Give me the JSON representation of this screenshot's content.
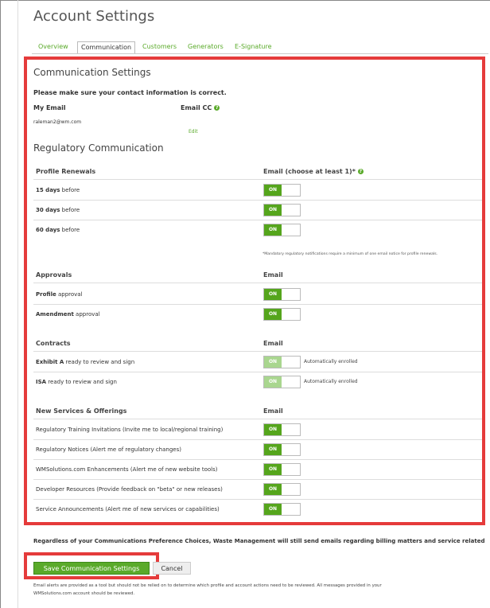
{
  "page": {
    "title": "Account Settings"
  },
  "tabs": [
    {
      "label": "Overview"
    },
    {
      "label": "Communication"
    },
    {
      "label": "Customers"
    },
    {
      "label": "Generators"
    },
    {
      "label": "E-Signature"
    }
  ],
  "communication": {
    "heading": "Communication Settings",
    "notice": "Please make sure your contact information is correct.",
    "my_email_label": "My Email",
    "my_email_value": "raleman2@wm.com",
    "email_cc_label": "Email CC",
    "edit_label": "Edit"
  },
  "regulatory": {
    "heading": "Regulatory Communication",
    "profile_renewals": {
      "header": "Profile Renewals",
      "email_header": "Email (choose at least 1)*",
      "rows": [
        {
          "bold": "15 days",
          "rest": " before",
          "toggle": "ON"
        },
        {
          "bold": "30 days",
          "rest": " before",
          "toggle": "ON"
        },
        {
          "bold": "60 days",
          "rest": " before",
          "toggle": "ON"
        }
      ],
      "footnote": "*Mandatory regulatory notifications require a minimum of one email notice for profile renewals."
    },
    "approvals": {
      "header": "Approvals",
      "email_header": "Email",
      "rows": [
        {
          "bold": "Profile",
          "rest": " approval",
          "toggle": "ON"
        },
        {
          "bold": "Amendment",
          "rest": " approval",
          "toggle": "ON"
        }
      ]
    },
    "contracts": {
      "header": "Contracts",
      "email_header": "Email",
      "rows": [
        {
          "bold": "Exhibit A",
          "rest": " ready to review and sign",
          "toggle": "ON",
          "note": "Automatically enrolled"
        },
        {
          "bold": "ISA",
          "rest": " ready to review and sign",
          "toggle": "ON",
          "note": "Automatically enrolled"
        }
      ]
    },
    "services": {
      "header": "New Services & Offerings",
      "email_header": "Email",
      "rows": [
        {
          "text": "Regulatory Training Invitations (Invite me to local/regional training)",
          "toggle": "ON"
        },
        {
          "text": "Regulatory Notices (Alert me of regulatory changes)",
          "toggle": "ON"
        },
        {
          "text": "WMSolutions.com Enhancements (Alert me of new website tools)",
          "toggle": "ON"
        },
        {
          "text": "Developer Resources (Provide feedback on \"beta\" or new releases)",
          "toggle": "ON"
        },
        {
          "text": "Service Announcements (Alert me of new services or capabilities)",
          "toggle": "ON"
        }
      ]
    }
  },
  "footer": {
    "billing_notice": "Regardless of your Communications Preference Choices, Waste Management will still send emails regarding billing matters and service related",
    "save_label": "Save Communication Settings",
    "cancel_label": "Cancel",
    "disclaimer_line1": "Email alerts are provided as a tool but should not be relied on to determine which profile and account actions need to be reviewed. All messages provided in your",
    "disclaimer_line2": "WMSolutions.com account should be reviewed."
  },
  "colors": {
    "accent_green": "#5aaa2a",
    "toggle_on": "#55a51c",
    "toggle_disabled": "#a9d68f",
    "highlight_red": "#e53b3b"
  }
}
